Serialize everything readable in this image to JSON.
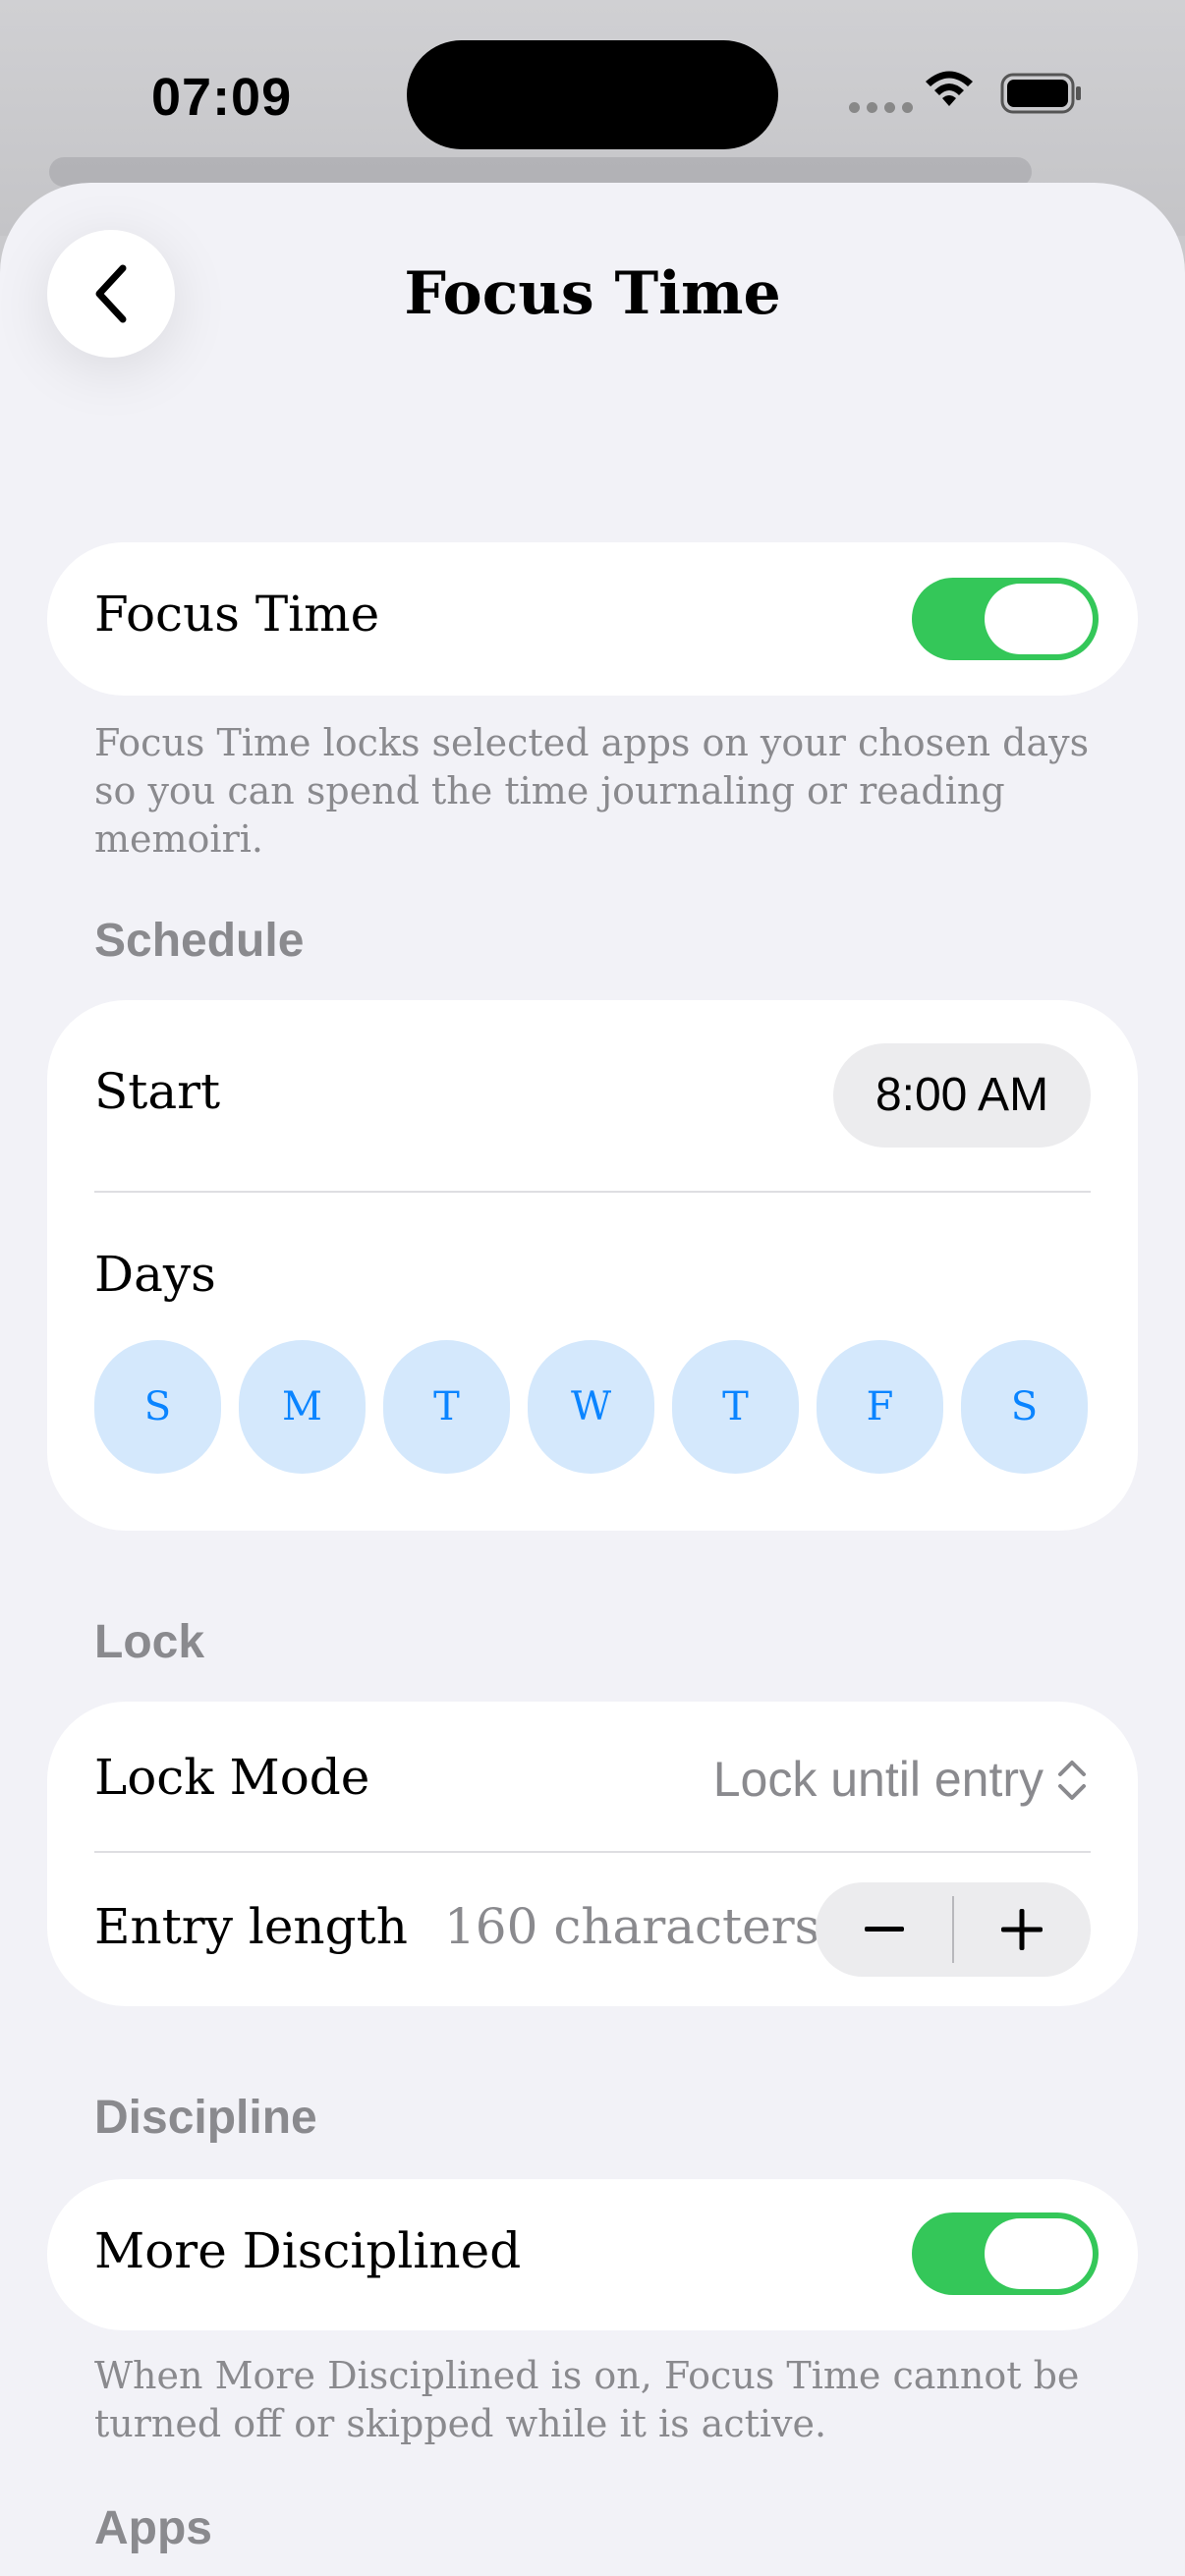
{
  "status_bar": {
    "time": "07:09"
  },
  "nav": {
    "title": "Focus Time",
    "back_icon": "chevron-left-icon"
  },
  "focus_card": {
    "label": "Focus Time",
    "toggle_on": true,
    "footnote": "Focus Time locks selected apps on your chosen days so you can spend the time journaling or reading memoiri."
  },
  "schedule": {
    "header": "Schedule",
    "start_label": "Start",
    "start_value": "8:00 AM",
    "days_label": "Days",
    "days": [
      "S",
      "M",
      "T",
      "W",
      "T",
      "F",
      "S"
    ]
  },
  "lock": {
    "header": "Lock",
    "mode_label": "Lock Mode",
    "mode_value": "Lock until entry",
    "entry_label": "Entry length",
    "entry_value": "160 characters",
    "decrement_symbol": "−",
    "increment_symbol": "+"
  },
  "discipline": {
    "header": "Discipline",
    "label": "More Disciplined",
    "toggle_on": true,
    "footnote": "When More Disciplined is on, Focus Time cannot be turned off or skipped while it is active."
  },
  "apps": {
    "header": "Apps"
  },
  "colors": {
    "accent_green": "#34c759",
    "day_fill": "#d4e8fc",
    "day_text": "#0a84ff",
    "sheet_bg": "#f2f2f7"
  }
}
